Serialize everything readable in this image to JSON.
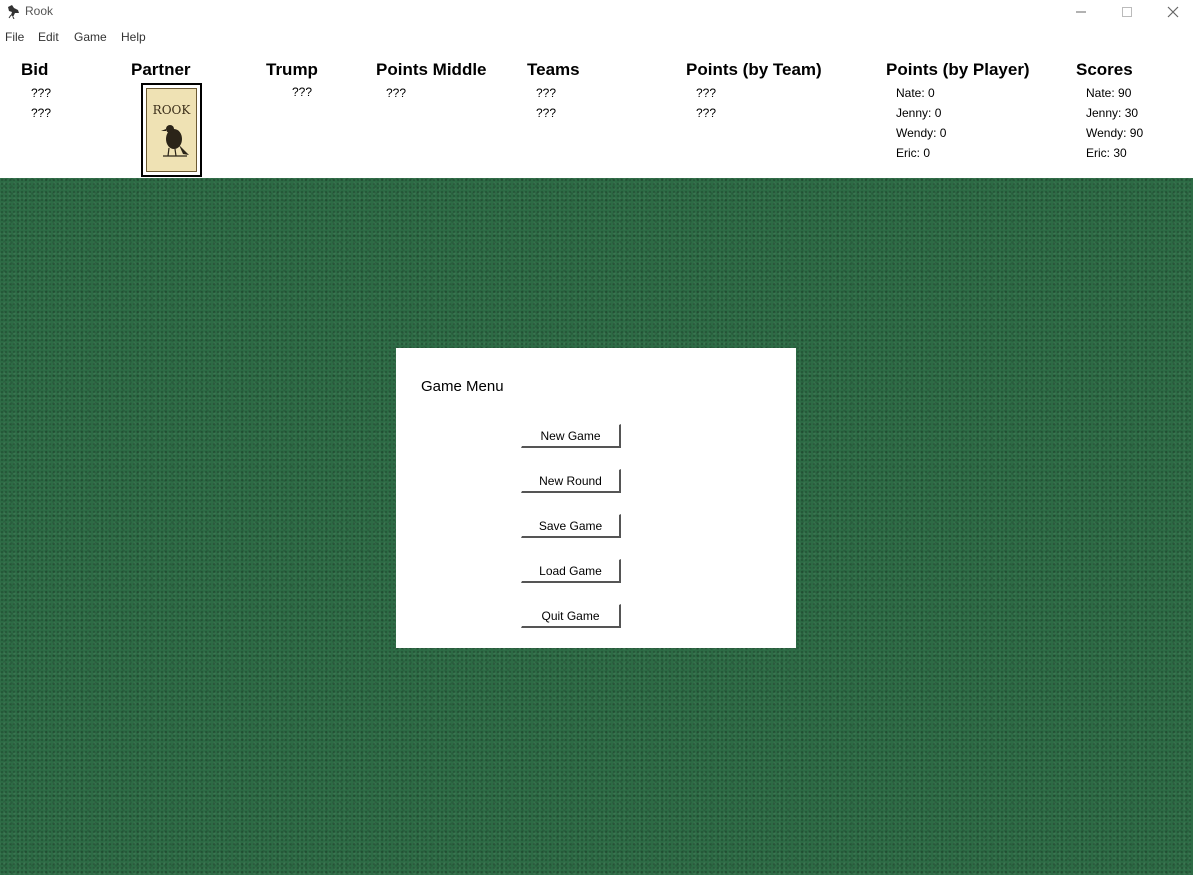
{
  "window": {
    "title": "Rook",
    "icon": "rook-bird-icon",
    "controls": [
      "minimize-icon",
      "maximize-icon",
      "close-icon"
    ]
  },
  "menubar": {
    "items": [
      {
        "label": "File"
      },
      {
        "label": "Edit"
      },
      {
        "label": "Game"
      },
      {
        "label": "Help"
      }
    ]
  },
  "header": {
    "bid": {
      "label": "Bid",
      "values": [
        "???",
        "???"
      ]
    },
    "partner": {
      "label": "Partner",
      "card_text": "ROOK"
    },
    "trump": {
      "label": "Trump",
      "values": [
        "???"
      ]
    },
    "points_middle": {
      "label": "Points Middle",
      "values": [
        "???"
      ]
    },
    "teams": {
      "label": "Teams",
      "values": [
        "???",
        "???"
      ]
    },
    "points_by_team": {
      "label": "Points (by Team)",
      "values": [
        "???",
        "???"
      ]
    },
    "points_by_player": {
      "label": "Points (by Player)",
      "values": [
        "Nate: 0",
        "Jenny: 0",
        "Wendy: 0",
        "Eric: 0"
      ]
    },
    "scores": {
      "label": "Scores",
      "values": [
        "Nate: 90",
        "Jenny: 30",
        "Wendy: 90",
        "Eric: 30"
      ]
    }
  },
  "colors": {
    "felt": "#2d6b45",
    "card": "#efe2b4"
  },
  "game_menu": {
    "title": "Game Menu",
    "buttons": [
      {
        "label": "New Game"
      },
      {
        "label": "New Round"
      },
      {
        "label": "Save Game"
      },
      {
        "label": "Load Game"
      },
      {
        "label": "Quit Game"
      }
    ]
  }
}
